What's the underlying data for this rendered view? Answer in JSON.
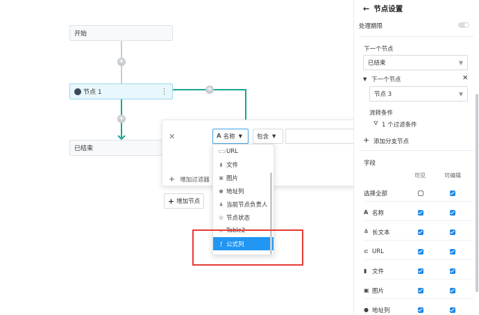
{
  "flow": {
    "start_label": "开始",
    "node1_label": "节点 1",
    "end_label": "已结束",
    "add_node_label": "增加节点",
    "line_color": "#16a58e"
  },
  "filter": {
    "field_value": "名称",
    "operator_value": "包含",
    "add_filter_label": "增加过滤器",
    "options": [
      {
        "icon": "link-icon",
        "label": "URL"
      },
      {
        "icon": "file-icon",
        "label": "文件"
      },
      {
        "icon": "image-icon",
        "label": "图片"
      },
      {
        "icon": "location-icon",
        "label": "地址列"
      },
      {
        "icon": "users-icon",
        "label": "当前节点负责人"
      },
      {
        "icon": "status-icon",
        "label": "节点状态"
      },
      {
        "icon": "list-icon",
        "label": "Table2"
      },
      {
        "icon": "formula-icon",
        "label": "公式列"
      }
    ],
    "selected_option": "公式列"
  },
  "panel": {
    "title": "节点设置",
    "deadline_label": "处理期限",
    "next_node_label": "下一个节点",
    "next_node_value": "已结束",
    "branch_label": "下一个节点",
    "branch_value": "节点 3",
    "condition_label": "流转条件",
    "condition_value": "1 个过滤条件",
    "add_branch_label": "添加分支节点",
    "fields_label": "字段",
    "col_visible": "可见",
    "col_editable": "可编辑",
    "fields": [
      {
        "icon": "",
        "name": "选择全部",
        "visible": false,
        "editable": true
      },
      {
        "icon": "text-icon",
        "name": "名称",
        "visible": true,
        "editable": true
      },
      {
        "icon": "long-text-icon",
        "name": "长文本",
        "visible": true,
        "editable": true
      },
      {
        "icon": "link-icon",
        "name": "URL",
        "visible": true,
        "editable": true
      },
      {
        "icon": "file-icon",
        "name": "文件",
        "visible": true,
        "editable": true
      },
      {
        "icon": "image-icon",
        "name": "图片",
        "visible": true,
        "editable": true
      },
      {
        "icon": "location-icon",
        "name": "地址列",
        "visible": true,
        "editable": true
      }
    ]
  }
}
